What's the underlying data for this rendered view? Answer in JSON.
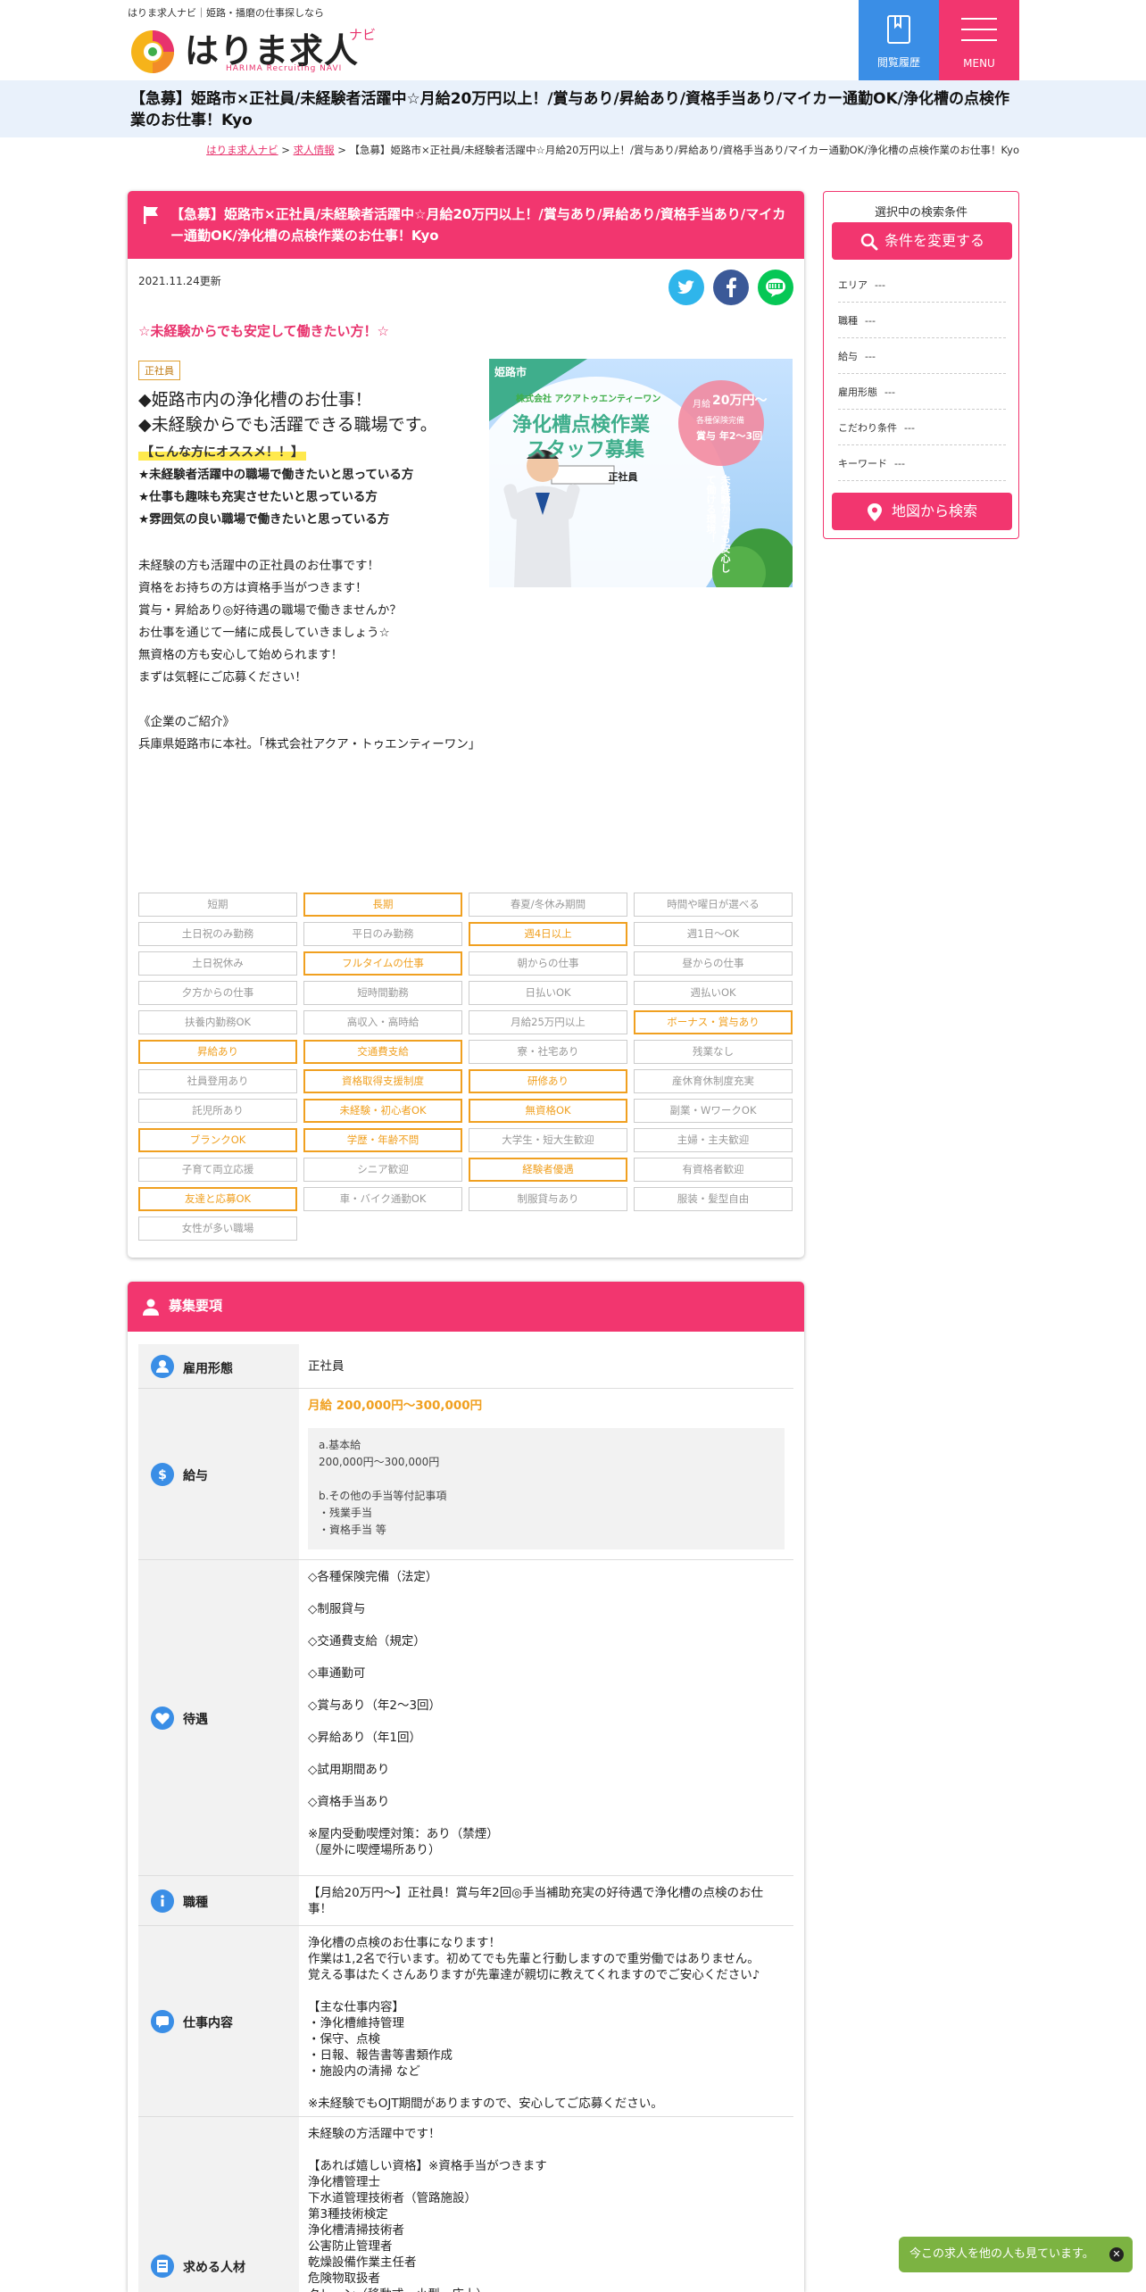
{
  "header": {
    "tagline": "はりま求人ナビ｜姫路・播磨の仕事探しなら",
    "logo_text": "はりま求人",
    "logo_navi": "ナビ",
    "logo_sub": "HARIMA Recruiting NAVI",
    "history_label": "閲覧履歴",
    "menu_label": "MENU"
  },
  "page_title": "【急募】姫路市×正社員/未経験者活躍中☆月給20万円以上！/賞与あり/昇給あり/資格手当あり/マイカー通勤OK/浄化槽の点検作業のお仕事！Kyo",
  "breadcrumb": {
    "home": "はりま求人ナビ",
    "sep1": " > ",
    "list": "求人情報",
    "sep2": " > ",
    "current": "【急募】姫路市×正社員/未経験者活躍中☆月給20万円以上！/賞与あり/昇給あり/資格手当あり/マイカー通勤OK/浄化槽の点検作業のお仕事！Kyo"
  },
  "job": {
    "title": "【急募】姫路市×正社員/未経験者活躍中☆月給20万円以上！/賞与あり/昇給あり/資格手当あり/マイカー通勤OK/浄化槽の点検作業のお仕事！Kyo",
    "updated": "2021.11.24更新",
    "catch": "☆未経験からでも安定して働きたい方！☆",
    "employment_badge": "正社員",
    "lead1": "◆姫路市内の浄化槽のお仕事！",
    "lead2": "◆未経験からでも活躍できる職場です。",
    "recommend": "【こんな方にオススメ！！】",
    "point1": "★未経験者活躍中の職場で働きたいと思っている方",
    "point2": "★仕事も趣味も充実させたいと思っている方",
    "point3": "★雰囲気の良い職場で働きたいと思っている方",
    "body": "未経験の方も活躍中の正社員のお仕事です！\n資格をお持ちの方は資格手当がつきます！\n賞与・昇給あり◎好待遇の職場で働きませんか？\nお仕事を通じて一緒に成長していきましょう☆\n無資格の方も安心して始められます！\nまずは気軽にご応募ください！\n\n《企業のご紹介》\n兵庫県姫路市に本社。「株式会社アクア・トゥエンティーワン」",
    "image": {
      "region": "姫路市",
      "company": "株式会社 アクアトゥエンティーワン",
      "headline1": "浄化槽点検作業",
      "headline2": "スタッフ募集",
      "badge": "正社員",
      "salary_label": "月給",
      "salary_value": "20万円～",
      "bonus_label": "各種保険完備",
      "bonus": "賞与 年2～3回",
      "vertical": "未経験からでも安心して働ける環境！"
    }
  },
  "tags": [
    {
      "label": "短期",
      "on": false
    },
    {
      "label": "長期",
      "on": true
    },
    {
      "label": "春夏/冬休み期間",
      "on": false
    },
    {
      "label": "時間や曜日が選べる",
      "on": false
    },
    {
      "label": "土日祝のみ勤務",
      "on": false
    },
    {
      "label": "平日のみ勤務",
      "on": false
    },
    {
      "label": "週4日以上",
      "on": true
    },
    {
      "label": "週1日～OK",
      "on": false
    },
    {
      "label": "土日祝休み",
      "on": false
    },
    {
      "label": "フルタイムの仕事",
      "on": true
    },
    {
      "label": "朝からの仕事",
      "on": false
    },
    {
      "label": "昼からの仕事",
      "on": false
    },
    {
      "label": "夕方からの仕事",
      "on": false
    },
    {
      "label": "短時間勤務",
      "on": false
    },
    {
      "label": "日払いOK",
      "on": false
    },
    {
      "label": "週払いOK",
      "on": false
    },
    {
      "label": "扶養内勤務OK",
      "on": false
    },
    {
      "label": "高収入・高時給",
      "on": false
    },
    {
      "label": "月給25万円以上",
      "on": false
    },
    {
      "label": "ボーナス・賞与あり",
      "on": true
    },
    {
      "label": "昇給あり",
      "on": true
    },
    {
      "label": "交通費支給",
      "on": true
    },
    {
      "label": "寮・社宅あり",
      "on": false
    },
    {
      "label": "残業なし",
      "on": false
    },
    {
      "label": "社員登用あり",
      "on": false
    },
    {
      "label": "資格取得支援制度",
      "on": true
    },
    {
      "label": "研修あり",
      "on": true
    },
    {
      "label": "産休育休制度充実",
      "on": false
    },
    {
      "label": "託児所あり",
      "on": false
    },
    {
      "label": "未経験・初心者OK",
      "on": true
    },
    {
      "label": "無資格OK",
      "on": true
    },
    {
      "label": "副業・WワークOK",
      "on": false
    },
    {
      "label": "ブランクOK",
      "on": true
    },
    {
      "label": "学歴・年齢不問",
      "on": true
    },
    {
      "label": "大学生・短大生歓迎",
      "on": false
    },
    {
      "label": "主婦・主夫歓迎",
      "on": false
    },
    {
      "label": "子育て両立応援",
      "on": false
    },
    {
      "label": "シニア歓迎",
      "on": false
    },
    {
      "label": "経験者優遇",
      "on": true
    },
    {
      "label": "有資格者歓迎",
      "on": false
    },
    {
      "label": "友達と応募OK",
      "on": true
    },
    {
      "label": "車・バイク通勤OK",
      "on": false
    },
    {
      "label": "制服貸与あり",
      "on": false
    },
    {
      "label": "服装・髪型自由",
      "on": false
    },
    {
      "label": "女性が多い職場",
      "on": false
    }
  ],
  "requirements": {
    "heading": "募集要項",
    "rows": {
      "employment": {
        "label": "雇用形態",
        "value": "正社員"
      },
      "salary": {
        "label": "給与",
        "highlight": "月給 200,000円～300,000円",
        "detail": "a.基本給\n200,000円～300,000円\n\nb.その他の手当等付記事項\n・残業手当\n・資格手当 等"
      },
      "benefits": {
        "label": "待遇",
        "value": "◇各種保険完備（法定）\n\n◇制服貸与\n\n◇交通費支給（規定）\n\n◇車通勤可\n\n◇賞与あり（年2～3回）\n\n◇昇給あり（年1回）\n\n◇試用期間あり\n\n◇資格手当あり\n\n※屋内受動喫煙対策：あり（禁煙）\n（屋外に喫煙場所あり）"
      },
      "occupation": {
        "label": "職種",
        "value": "【月給20万円～】正社員！賞与年2回◎手当補助充実の好待遇で浄化槽の点検のお仕事！"
      },
      "work": {
        "label": "仕事内容",
        "value": "浄化槽の点検のお仕事になります！\n作業は1,2名で行います。初めてでも先輩と行動しますので重労働ではありません。\n覚える事はたくさんありますが先輩達が親切に教えてくれますのでご安心ください♪\n\n【主な仕事内容】\n・浄化槽維持管理\n・保守、点検\n・日報、報告書等書類作成\n・施設内の清掃 など\n\n※未経験でもOJT期間がありますので、安心してご応募ください。"
      },
      "wanted": {
        "label": "求める人材",
        "value": "未経験の方活躍中です！\n\n【あれば嬉しい資格】※資格手当がつきます\n浄化槽管理士\n下水道管理技術者（管路施設）\n第3種技術検定\n浄化槽清掃技術者\n公害防止管理者\n乾燥設備作業主任者\n危険物取扱者\nクレーン（移動式、小型、床上）"
      }
    }
  },
  "sidebar": {
    "title": "選択中の検索条件",
    "change_button": "条件を変更する",
    "conditions": [
      {
        "label": "エリア",
        "value": "---"
      },
      {
        "label": "職種",
        "value": "---"
      },
      {
        "label": "給与",
        "value": "---"
      },
      {
        "label": "雇用形態",
        "value": "---"
      },
      {
        "label": "こだわり条件",
        "value": "---"
      },
      {
        "label": "キーワード",
        "value": "---"
      }
    ],
    "map_button": "地図から検索"
  },
  "toast": {
    "text": "今この求人を他の人も見ています。"
  },
  "colors": {
    "accent": "#f2366f",
    "blue": "#3a8ee6",
    "tag_on": "#f0a020",
    "toast": "#7cb342"
  }
}
